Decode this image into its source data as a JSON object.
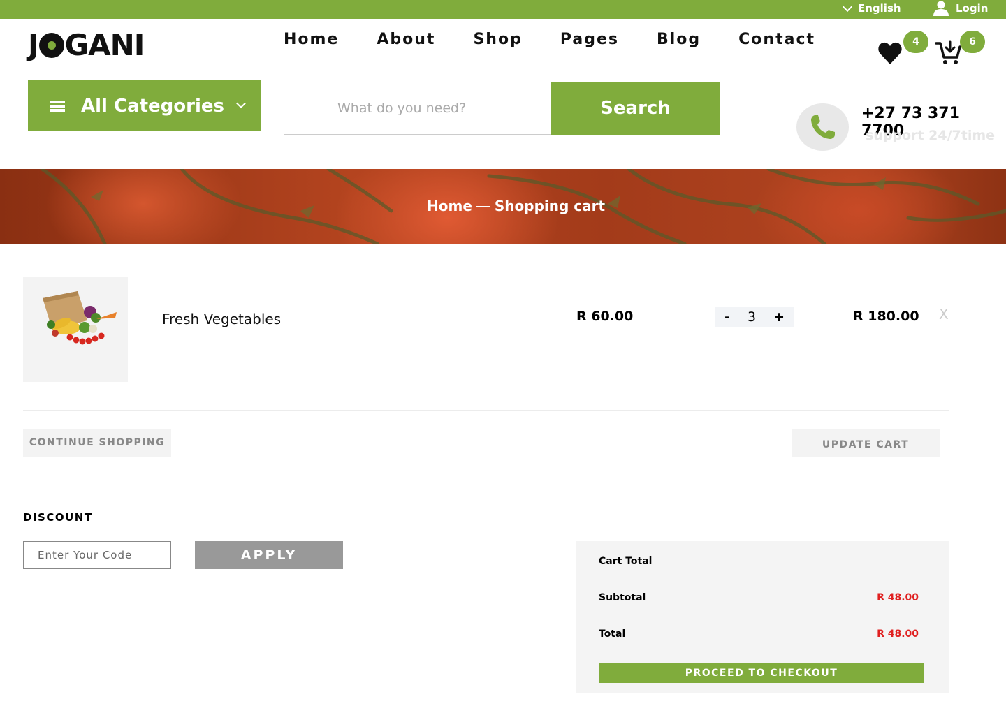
{
  "topbar": {
    "language": "English",
    "login": "Login"
  },
  "brand": {
    "logo_parts": [
      "J",
      "GANI"
    ]
  },
  "nav": [
    "Home",
    "About",
    "Shop",
    "Pages",
    "Blog",
    "Contact"
  ],
  "header": {
    "wishlist_count": "4",
    "cart_count": "6"
  },
  "categories": {
    "label": "All Categories"
  },
  "search": {
    "placeholder": "What do you need?",
    "button": "Search"
  },
  "contact": {
    "phone": "+27 73 371 7700",
    "support": "support 24/7time"
  },
  "breadcrumb": {
    "home": "Home",
    "current": "Shopping cart"
  },
  "cart": {
    "item": {
      "name": "Fresh Vegetables",
      "price": "R 60.00",
      "quantity": "3",
      "total": "R 180.00",
      "remove": "X",
      "minus": "-",
      "plus": "+"
    },
    "continue": "CONTINUE SHOPPING",
    "update": "UPDATE CART"
  },
  "discount": {
    "title": "DISCOUNT",
    "placeholder": "Enter Your Code",
    "apply": "APPLY"
  },
  "totals": {
    "title": "Cart Total",
    "subtotal_label": "Subtotal",
    "subtotal_value": "R 48.00",
    "total_label": "Total",
    "total_value": "R 48.00",
    "checkout": "PROCEED TO CHECKOUT"
  },
  "colors": {
    "brand_green": "#80ac3c",
    "price_red": "#e02020"
  },
  "icons": [
    "chevron-down-icon",
    "user-icon",
    "heart-icon",
    "cart-icon",
    "menu-icon",
    "phone-icon",
    "vegetable-bag-image"
  ]
}
